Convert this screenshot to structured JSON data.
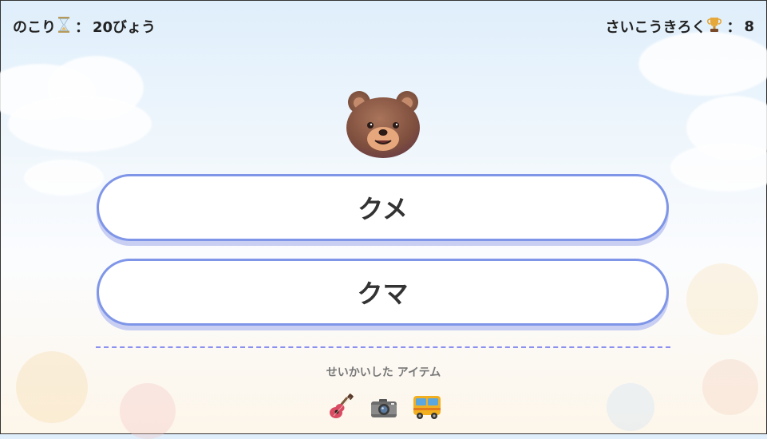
{
  "hud": {
    "time_label": "のこり",
    "time_icon": "hourglass-icon",
    "time_value": "20びょう",
    "best_label": "さいこうきろく",
    "best_icon": "trophy-icon",
    "best_value": "8",
    "colon": "："
  },
  "question": {
    "icon": "bear-face-icon"
  },
  "answers": [
    {
      "label": "クメ"
    },
    {
      "label": "クマ"
    }
  ],
  "items": {
    "label": "せいかいした アイテム",
    "list": [
      "guitar-icon",
      "camera-icon",
      "bus-icon"
    ]
  },
  "colors": {
    "button_border": "#7f95e8",
    "divider": "#8b8ff0",
    "bear_brown": "#8a5a44"
  }
}
